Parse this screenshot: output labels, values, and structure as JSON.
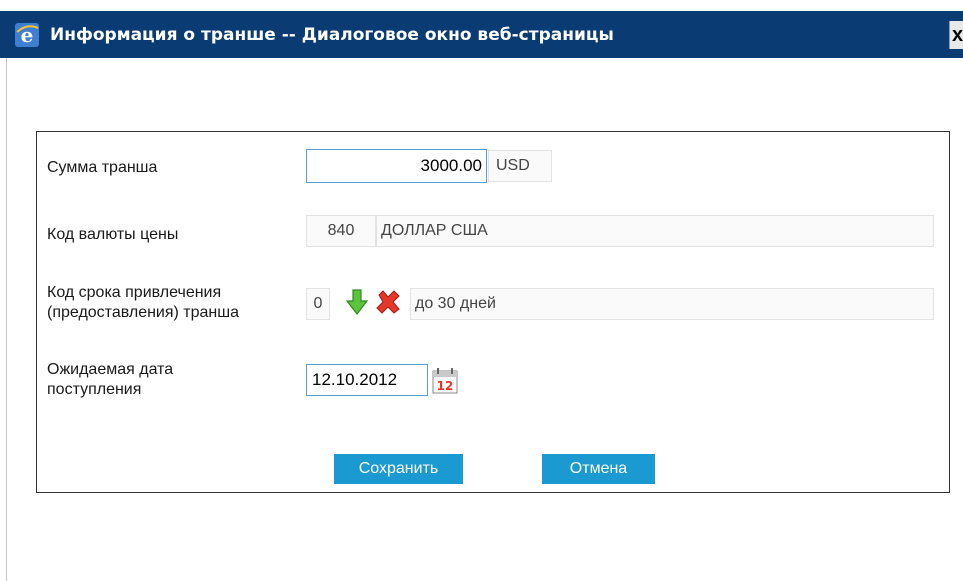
{
  "window": {
    "title": "Информация о транше -- Диалоговое окно веб-страницы",
    "close_label": "x"
  },
  "form": {
    "amount": {
      "label": "Сумма транша",
      "value": "3000.00",
      "currency": "USD"
    },
    "price_currency": {
      "label": "Код валюты цены",
      "code": "840",
      "name": "ДОЛЛАР США"
    },
    "term": {
      "label_line1": "Код срока привлечения",
      "label_line2": "(предоставления) транша",
      "code": "0",
      "name": "до 30 дней"
    },
    "expected_date": {
      "label_line1": "Ожидаемая дата",
      "label_line2": "поступления",
      "value": "12.10.2012",
      "calendar_day": "12"
    }
  },
  "buttons": {
    "save": "Сохранить",
    "cancel": "Отмена"
  },
  "colors": {
    "titlebar": "#0b3b73",
    "button": "#1a9ad0",
    "input_border": "#5a9ed6"
  },
  "icons": {
    "window": "ie-icon",
    "select": "green-down-arrow-icon",
    "clear": "red-x-icon",
    "calendar": "calendar-icon"
  }
}
